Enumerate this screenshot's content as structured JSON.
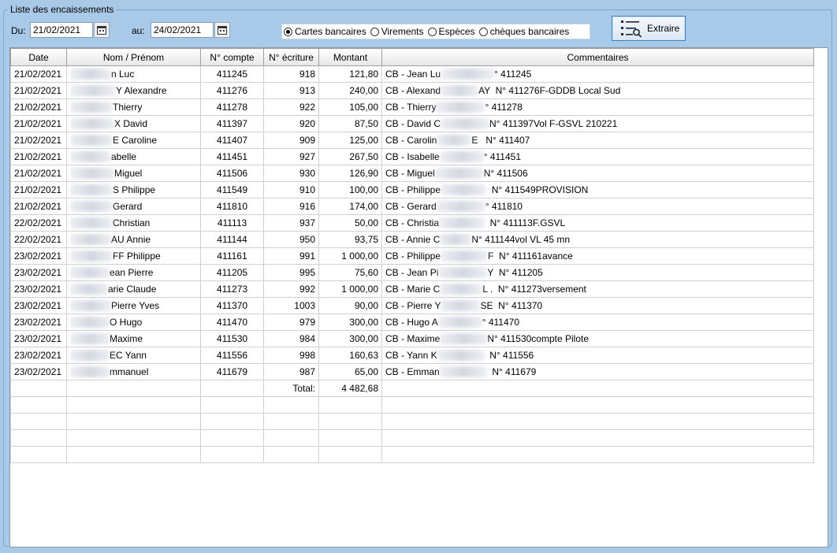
{
  "window": {
    "group_title": "Liste des encaissements"
  },
  "filters": {
    "from_label": "Du:",
    "from_value": "21/02/2021",
    "to_label": "au:",
    "to_value": "24/02/2021",
    "payment_types": [
      {
        "label": "Cartes bancaires",
        "selected": true
      },
      {
        "label": "Virements",
        "selected": false
      },
      {
        "label": "Espèces",
        "selected": false
      },
      {
        "label": "chèques bancaires",
        "selected": false
      }
    ],
    "extract_label": "Extraire",
    "extract_icon": "filter-search-icon"
  },
  "table": {
    "columns": [
      "Date",
      "Nom / Prénom",
      "N° compte",
      "N° écriture",
      "Montant",
      "Commentaires"
    ],
    "rows": [
      {
        "date": "21/02/2021",
        "name": "n Luc",
        "account": "411245",
        "entry": "918",
        "amount": "121,80",
        "comment_a": "CB - Jean Lu",
        "comment_b": "° 411245"
      },
      {
        "date": "21/02/2021",
        "name": "Y Alexandre",
        "account": "411276",
        "entry": "913",
        "amount": "240,00",
        "comment_a": "CB - Alexand",
        "comment_b": "AY  N° 411276F-GDDB Local Sud"
      },
      {
        "date": "21/02/2021",
        "name": "Thierry",
        "account": "411278",
        "entry": "922",
        "amount": "105,00",
        "comment_a": "CB - Thierry",
        "comment_b": "° 411278"
      },
      {
        "date": "21/02/2021",
        "name": "X David",
        "account": "411397",
        "entry": "920",
        "amount": "87,50",
        "comment_a": "CB - David  C",
        "comment_b": "N° 411397Vol F-GSVL 210221"
      },
      {
        "date": "21/02/2021",
        "name": "E Caroline",
        "account": "411407",
        "entry": "909",
        "amount": "125,00",
        "comment_a": "CB - Carolin",
        "comment_b": "E   N° 411407"
      },
      {
        "date": "21/02/2021",
        "name": "abelle",
        "account": "411451",
        "entry": "927",
        "amount": "267,50",
        "comment_a": "CB - Isabelle",
        "comment_b": "° 411451"
      },
      {
        "date": "21/02/2021",
        "name": "Miguel",
        "account": "411506",
        "entry": "930",
        "amount": "126,90",
        "comment_a": "CB - Miguel",
        "comment_b": "N° 411506"
      },
      {
        "date": "21/02/2021",
        "name": "S Philippe",
        "account": "411549",
        "entry": "910",
        "amount": "100,00",
        "comment_a": "CB - Philippe",
        "comment_b": "  N° 411549PROVISION"
      },
      {
        "date": "21/02/2021",
        "name": "Gerard",
        "account": "411810",
        "entry": "916",
        "amount": "174,00",
        "comment_a": "CB - Gerard",
        "comment_b": "° 411810"
      },
      {
        "date": "22/02/2021",
        "name": "Christian",
        "account": "411113",
        "entry": "937",
        "amount": "50,00",
        "comment_a": "CB - Christia",
        "comment_b": "  N° 411113F.GSVL"
      },
      {
        "date": "22/02/2021",
        "name": "AU Annie",
        "account": "411144",
        "entry": "950",
        "amount": "93,75",
        "comment_a": "CB - Annie  C",
        "comment_b": "N° 411144vol VL 45 mn"
      },
      {
        "date": "23/02/2021",
        "name": "FF Philippe",
        "account": "411161",
        "entry": "991",
        "amount": "1 000,00",
        "comment_a": "CB - Philippe",
        "comment_b": "F  N° 411161avance"
      },
      {
        "date": "23/02/2021",
        "name": "ean Pierre",
        "account": "411205",
        "entry": "995",
        "amount": "75,60",
        "comment_a": "CB - Jean Pi",
        "comment_b": "Y  N° 411205"
      },
      {
        "date": "23/02/2021",
        "name": "arie Claude",
        "account": "411273",
        "entry": "992",
        "amount": "1 000,00",
        "comment_a": "CB - Marie C",
        "comment_b": "L .  N° 411273versement"
      },
      {
        "date": "23/02/2021",
        "name": "Pierre Yves",
        "account": "411370",
        "entry": "1003",
        "amount": "90,00",
        "comment_a": "CB - Pierre Y",
        "comment_b": "SE  N° 411370"
      },
      {
        "date": "23/02/2021",
        "name": "O Hugo",
        "account": "411470",
        "entry": "979",
        "amount": "300,00",
        "comment_a": "CB - Hugo  A",
        "comment_b": "° 411470"
      },
      {
        "date": "23/02/2021",
        "name": "Maxime",
        "account": "411530",
        "entry": "984",
        "amount": "300,00",
        "comment_a": "CB - Maxime",
        "comment_b": "N° 411530compte Pilote"
      },
      {
        "date": "23/02/2021",
        "name": "EC Yann",
        "account": "411556",
        "entry": "998",
        "amount": "160,63",
        "comment_a": "CB - Yann  K",
        "comment_b": "  N° 411556"
      },
      {
        "date": "23/02/2021",
        "name": "mmanuel",
        "account": "411679",
        "entry": "987",
        "amount": "65,00",
        "comment_a": "CB - Emman",
        "comment_b": "  N° 411679"
      }
    ],
    "total_label": "Total:",
    "total_value": "4 482,68"
  }
}
